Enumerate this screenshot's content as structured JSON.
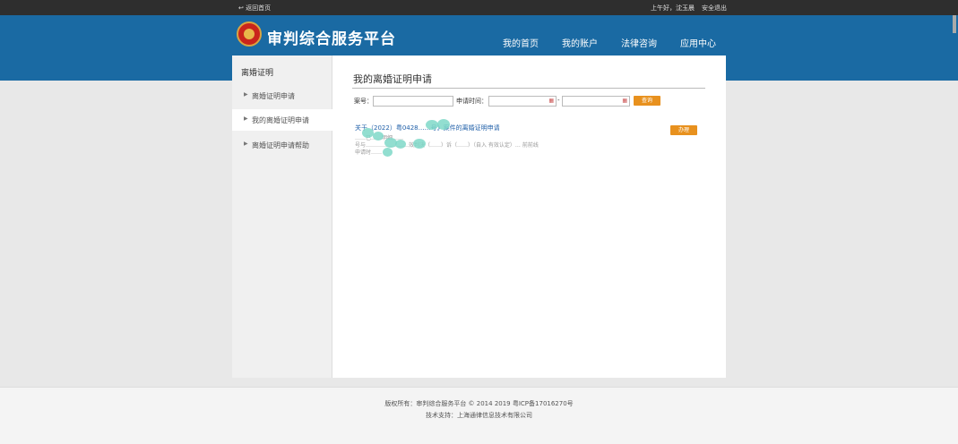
{
  "topbar": {
    "back_label": "↩ 返回首页",
    "greeting": "上午好，沈玉晨",
    "logout": "安全退出"
  },
  "header": {
    "site_title": "审判综合服务平台",
    "nav": [
      "我的首页",
      "我的账户",
      "法律咨询",
      "应用中心"
    ]
  },
  "sidebar": {
    "title": "离婚证明",
    "items": [
      {
        "label": "离婚证明申请"
      },
      {
        "label": "我的离婚证明申请",
        "active": true
      },
      {
        "label": "离婚证明申请帮助"
      }
    ]
  },
  "content": {
    "title": "我的离婚证明申请",
    "filters": {
      "case_no_label": "案号：",
      "apply_time_label": "申请时间：",
      "range_sep": "-",
      "query_button": "查询"
    },
    "item": {
      "title": "关于（2022）粤0428……号》案件的离婚证明申请",
      "line1": "……已……明细……",
      "line2": "号与……………………效判决（……）诉（……）（自入 有效认定）… 前前线",
      "line3": "申请时……",
      "action": "办理"
    }
  },
  "footer": {
    "line1": "版权所有：审判综合服务平台 © 2014  2019 粤ICP备17016270号",
    "line2": "技术支持：上海通律信息技术有限公司"
  },
  "colors": {
    "header_blue": "#1a6aa3",
    "accent_orange": "#e8911e",
    "link_blue": "#1f5fa8"
  }
}
